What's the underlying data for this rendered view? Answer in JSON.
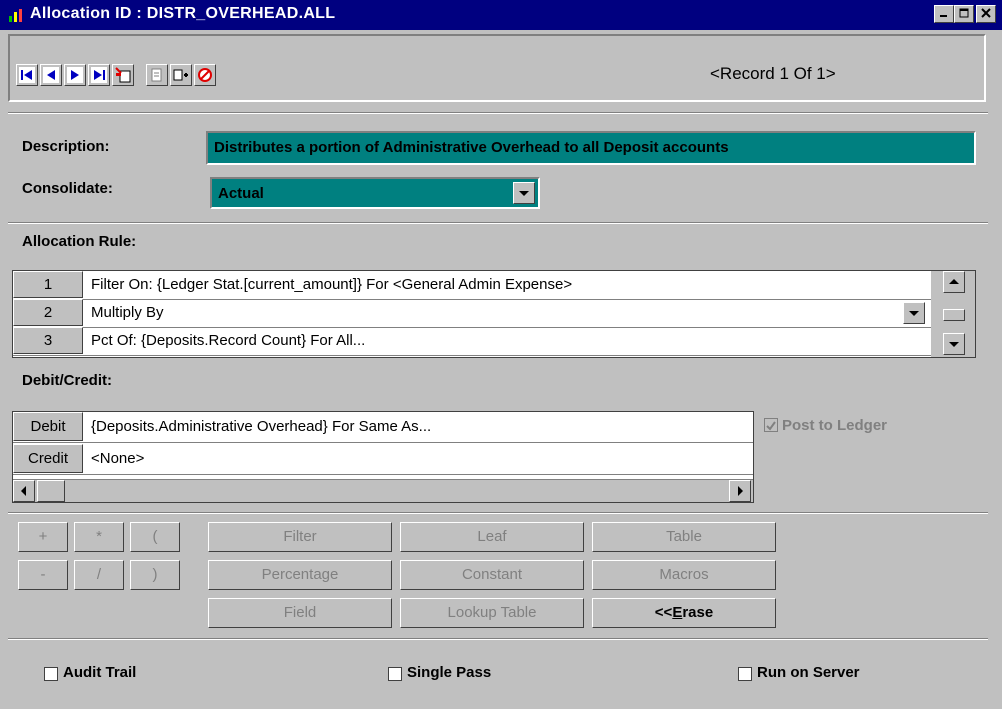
{
  "window": {
    "title": "Allocation ID : DISTR_OVERHEAD.ALL",
    "controls": [
      "minimize",
      "maximize",
      "close"
    ]
  },
  "toolbar": {
    "record_indicator": "<Record 1 Of 1>",
    "buttons": [
      "first-record",
      "previous-record",
      "next-record",
      "last-record",
      "new-record",
      "copy",
      "insert",
      "delete"
    ]
  },
  "form": {
    "description_label": "Description:",
    "description_value": "Distributes a portion of Administrative Overhead to all Deposit accounts",
    "consolidate_label": "Consolidate:",
    "consolidate_value": "Actual"
  },
  "allocation_rule": {
    "label": "Allocation Rule:",
    "rows": [
      {
        "num": "1",
        "text": "Filter On: {Ledger Stat.[current_amount]} For  <General Admin Expense>"
      },
      {
        "num": "2",
        "text": "Multiply By"
      },
      {
        "num": "3",
        "text": "Pct Of: {Deposits.Record Count} For  All..."
      }
    ]
  },
  "debit_credit": {
    "label": "Debit/Credit:",
    "debit_label": "Debit",
    "debit_value": "{Deposits.Administrative Overhead} For  Same As...",
    "credit_label": "Credit",
    "credit_value": "<None>",
    "post_to_ledger_label": "Post to Ledger",
    "post_to_ledger_checked": true
  },
  "operators": [
    "+",
    "*",
    "(",
    "-",
    "/",
    ")"
  ],
  "functions": {
    "filter": "Filter",
    "leaf": "Leaf",
    "table": "Table",
    "percentage": "Percentage",
    "constant": "Constant",
    "macros": "Macros",
    "field": "Field",
    "lookup_table": "Lookup Table",
    "erase_prefix": "<<",
    "erase_hotkey": "E",
    "erase_rest": "rase"
  },
  "options": {
    "audit_trail": "Audit Trail",
    "single_pass": "Single Pass",
    "run_on_server": "Run on Server"
  }
}
